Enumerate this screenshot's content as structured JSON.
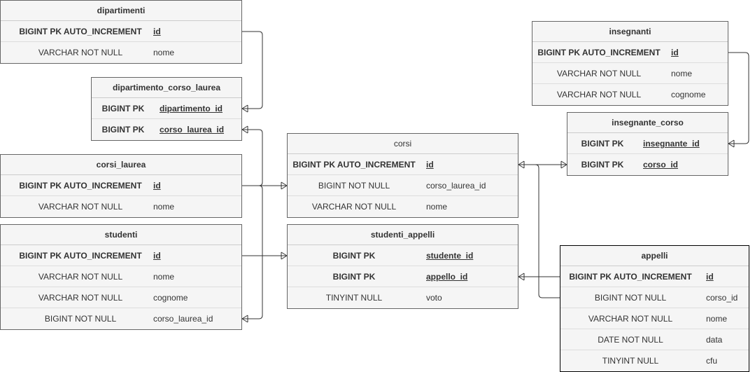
{
  "tables": {
    "dipartimenti": {
      "title": "dipartimenti",
      "rows": [
        {
          "type": "BIGINT PK AUTO_INCREMENT",
          "name": "id"
        },
        {
          "type": "VARCHAR NOT NULL",
          "name": "nome"
        }
      ]
    },
    "dipartimento_corso_laurea": {
      "title": "dipartimento_corso_laurea",
      "rows": [
        {
          "type": "BIGINT PK",
          "name": "dipartimento_id"
        },
        {
          "type": "BIGINT PK",
          "name": "corso_laurea_id"
        }
      ]
    },
    "corsi_laurea": {
      "title": "corsi_laurea",
      "rows": [
        {
          "type": "BIGINT PK AUTO_INCREMENT",
          "name": "id"
        },
        {
          "type": "VARCHAR NOT NULL",
          "name": "nome"
        }
      ]
    },
    "studenti": {
      "title": "studenti",
      "rows": [
        {
          "type": "BIGINT PK AUTO_INCREMENT",
          "name": "id"
        },
        {
          "type": "VARCHAR NOT NULL",
          "name": "nome"
        },
        {
          "type": "VARCHAR NOT NULL",
          "name": "cognome"
        },
        {
          "type": "BIGINT NOT NULL",
          "name": "corso_laurea_id"
        }
      ]
    },
    "corsi": {
      "title": "corsi",
      "rows": [
        {
          "type": "BIGINT PK AUTO_INCREMENT",
          "name": "id"
        },
        {
          "type": "BIGINT NOT NULL",
          "name": "corso_laurea_id"
        },
        {
          "type": "VARCHAR NOT NULL",
          "name": "nome"
        }
      ]
    },
    "studenti_appelli": {
      "title": "studenti_appelli",
      "rows": [
        {
          "type": "BIGINT PK",
          "name": "studente_id"
        },
        {
          "type": "BIGINT PK",
          "name": "appello_id"
        },
        {
          "type": "TINYINT NULL",
          "name": "voto"
        }
      ]
    },
    "insegnanti": {
      "title": "insegnanti",
      "rows": [
        {
          "type": "BIGINT PK AUTO_INCREMENT",
          "name": "id"
        },
        {
          "type": "VARCHAR NOT NULL",
          "name": "nome"
        },
        {
          "type": "VARCHAR NOT NULL",
          "name": "cognome"
        }
      ]
    },
    "insegnante_corso": {
      "title": "insegnante_corso",
      "rows": [
        {
          "type": "BIGINT PK",
          "name": "insegnante_id"
        },
        {
          "type": "BIGINT PK",
          "name": "corso_id"
        }
      ]
    },
    "appelli": {
      "title": "appelli",
      "rows": [
        {
          "type": "BIGINT PK AUTO_INCREMENT",
          "name": "id"
        },
        {
          "type": "BIGINT NOT NULL",
          "name": "corso_id"
        },
        {
          "type": "VARCHAR NOT NULL",
          "name": "nome"
        },
        {
          "type": "DATE NOT NULL",
          "name": "data"
        },
        {
          "type": "TINYINT NULL",
          "name": "cfu"
        }
      ]
    }
  }
}
